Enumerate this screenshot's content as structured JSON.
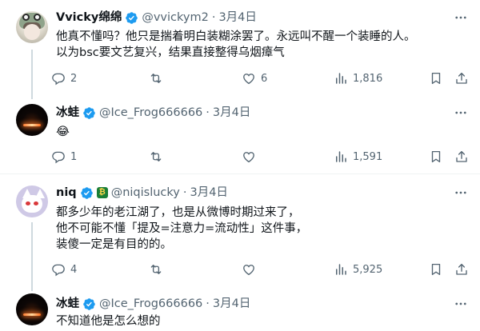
{
  "colors": {
    "text_primary": "#0f1419",
    "text_secondary": "#536471",
    "verified_blue": "#1d9bf0",
    "divider": "#eff3f4",
    "thread_line": "#cfd9de"
  },
  "tweets": [
    {
      "display_name": "Vvicky绵绵",
      "handle": "@vvickym2",
      "time": "3月4日",
      "lines": [
        "他真不懂吗？他只是揣着明白装糊涂罢了。永远叫不醒一个装睡的人。",
        "以为bsc要文艺复兴，结果直接整得乌烟瘴气"
      ],
      "replies": "2",
      "retweets": "",
      "likes": "6",
      "views": "1,816"
    },
    {
      "display_name": "冰蛙",
      "handle": "@Ice_Frog666666",
      "time": "3月4日",
      "lines": [
        "😂"
      ],
      "replies": "1",
      "retweets": "",
      "likes": "",
      "views": "1,591"
    },
    {
      "display_name": "niq",
      "handle": "@niqislucky",
      "time": "3月4日",
      "lines": [
        "都多少年的老江湖了，也是从微博时期过来了，",
        "他不可能不懂「提及=注意力=流动性」这件事，",
        "装傻一定是有目的的。"
      ],
      "replies": "4",
      "retweets": "",
      "likes": "",
      "views": "5,925"
    },
    {
      "display_name": "冰蛙",
      "handle": "@Ice_Frog666666",
      "time": "3月4日",
      "lines": [
        "不知道他是怎么想的"
      ]
    }
  ]
}
